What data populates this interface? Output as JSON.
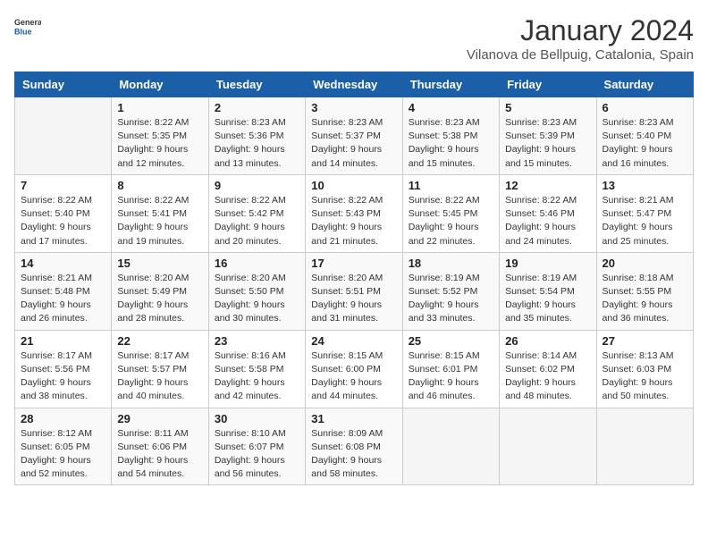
{
  "logo": {
    "line1": "General",
    "line2": "Blue"
  },
  "title": "January 2024",
  "subtitle": "Vilanova de Bellpuig, Catalonia, Spain",
  "headers": [
    "Sunday",
    "Monday",
    "Tuesday",
    "Wednesday",
    "Thursday",
    "Friday",
    "Saturday"
  ],
  "weeks": [
    [
      {
        "day": "",
        "info": ""
      },
      {
        "day": "1",
        "info": "Sunrise: 8:22 AM\nSunset: 5:35 PM\nDaylight: 9 hours\nand 12 minutes."
      },
      {
        "day": "2",
        "info": "Sunrise: 8:23 AM\nSunset: 5:36 PM\nDaylight: 9 hours\nand 13 minutes."
      },
      {
        "day": "3",
        "info": "Sunrise: 8:23 AM\nSunset: 5:37 PM\nDaylight: 9 hours\nand 14 minutes."
      },
      {
        "day": "4",
        "info": "Sunrise: 8:23 AM\nSunset: 5:38 PM\nDaylight: 9 hours\nand 15 minutes."
      },
      {
        "day": "5",
        "info": "Sunrise: 8:23 AM\nSunset: 5:39 PM\nDaylight: 9 hours\nand 15 minutes."
      },
      {
        "day": "6",
        "info": "Sunrise: 8:23 AM\nSunset: 5:40 PM\nDaylight: 9 hours\nand 16 minutes."
      }
    ],
    [
      {
        "day": "7",
        "info": "Sunrise: 8:22 AM\nSunset: 5:40 PM\nDaylight: 9 hours\nand 17 minutes."
      },
      {
        "day": "8",
        "info": "Sunrise: 8:22 AM\nSunset: 5:41 PM\nDaylight: 9 hours\nand 19 minutes."
      },
      {
        "day": "9",
        "info": "Sunrise: 8:22 AM\nSunset: 5:42 PM\nDaylight: 9 hours\nand 20 minutes."
      },
      {
        "day": "10",
        "info": "Sunrise: 8:22 AM\nSunset: 5:43 PM\nDaylight: 9 hours\nand 21 minutes."
      },
      {
        "day": "11",
        "info": "Sunrise: 8:22 AM\nSunset: 5:45 PM\nDaylight: 9 hours\nand 22 minutes."
      },
      {
        "day": "12",
        "info": "Sunrise: 8:22 AM\nSunset: 5:46 PM\nDaylight: 9 hours\nand 24 minutes."
      },
      {
        "day": "13",
        "info": "Sunrise: 8:21 AM\nSunset: 5:47 PM\nDaylight: 9 hours\nand 25 minutes."
      }
    ],
    [
      {
        "day": "14",
        "info": "Sunrise: 8:21 AM\nSunset: 5:48 PM\nDaylight: 9 hours\nand 26 minutes."
      },
      {
        "day": "15",
        "info": "Sunrise: 8:20 AM\nSunset: 5:49 PM\nDaylight: 9 hours\nand 28 minutes."
      },
      {
        "day": "16",
        "info": "Sunrise: 8:20 AM\nSunset: 5:50 PM\nDaylight: 9 hours\nand 30 minutes."
      },
      {
        "day": "17",
        "info": "Sunrise: 8:20 AM\nSunset: 5:51 PM\nDaylight: 9 hours\nand 31 minutes."
      },
      {
        "day": "18",
        "info": "Sunrise: 8:19 AM\nSunset: 5:52 PM\nDaylight: 9 hours\nand 33 minutes."
      },
      {
        "day": "19",
        "info": "Sunrise: 8:19 AM\nSunset: 5:54 PM\nDaylight: 9 hours\nand 35 minutes."
      },
      {
        "day": "20",
        "info": "Sunrise: 8:18 AM\nSunset: 5:55 PM\nDaylight: 9 hours\nand 36 minutes."
      }
    ],
    [
      {
        "day": "21",
        "info": "Sunrise: 8:17 AM\nSunset: 5:56 PM\nDaylight: 9 hours\nand 38 minutes."
      },
      {
        "day": "22",
        "info": "Sunrise: 8:17 AM\nSunset: 5:57 PM\nDaylight: 9 hours\nand 40 minutes."
      },
      {
        "day": "23",
        "info": "Sunrise: 8:16 AM\nSunset: 5:58 PM\nDaylight: 9 hours\nand 42 minutes."
      },
      {
        "day": "24",
        "info": "Sunrise: 8:15 AM\nSunset: 6:00 PM\nDaylight: 9 hours\nand 44 minutes."
      },
      {
        "day": "25",
        "info": "Sunrise: 8:15 AM\nSunset: 6:01 PM\nDaylight: 9 hours\nand 46 minutes."
      },
      {
        "day": "26",
        "info": "Sunrise: 8:14 AM\nSunset: 6:02 PM\nDaylight: 9 hours\nand 48 minutes."
      },
      {
        "day": "27",
        "info": "Sunrise: 8:13 AM\nSunset: 6:03 PM\nDaylight: 9 hours\nand 50 minutes."
      }
    ],
    [
      {
        "day": "28",
        "info": "Sunrise: 8:12 AM\nSunset: 6:05 PM\nDaylight: 9 hours\nand 52 minutes."
      },
      {
        "day": "29",
        "info": "Sunrise: 8:11 AM\nSunset: 6:06 PM\nDaylight: 9 hours\nand 54 minutes."
      },
      {
        "day": "30",
        "info": "Sunrise: 8:10 AM\nSunset: 6:07 PM\nDaylight: 9 hours\nand 56 minutes."
      },
      {
        "day": "31",
        "info": "Sunrise: 8:09 AM\nSunset: 6:08 PM\nDaylight: 9 hours\nand 58 minutes."
      },
      {
        "day": "",
        "info": ""
      },
      {
        "day": "",
        "info": ""
      },
      {
        "day": "",
        "info": ""
      }
    ]
  ]
}
